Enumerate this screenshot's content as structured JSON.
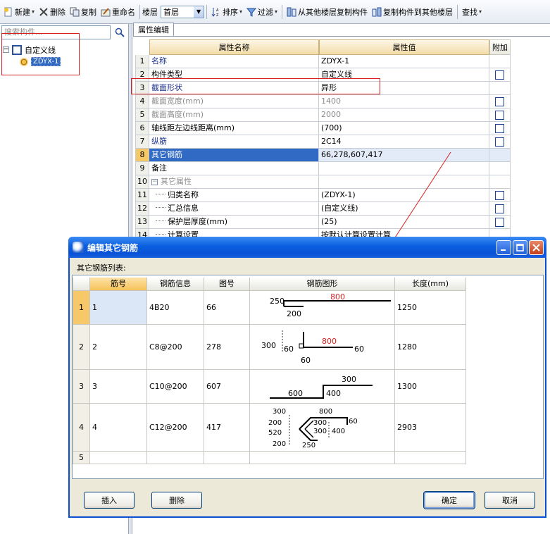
{
  "toolbar": {
    "new_label": "新建",
    "delete_label": "删除",
    "copy_label": "复制",
    "rename_label": "重命名",
    "floor_label": "楼层",
    "floor_value": "首层",
    "sort_label": "排序",
    "filter_label": "过滤",
    "copy_from_label": "从其他楼层复制构件",
    "copy_to_label": "复制构件到其他楼层",
    "find_label": "查找"
  },
  "left_panel": {
    "search_placeholder": "搜索构件...",
    "tree_root_label": "自定义线",
    "tree_child_label": "ZDYX-1"
  },
  "prop_grid": {
    "tab_label": "属性编辑",
    "col_name": "属性名称",
    "col_value": "属性值",
    "col_extra": "附加",
    "rows": [
      {
        "num": "1",
        "name": "名称",
        "value": "ZDYX-1"
      },
      {
        "num": "2",
        "name": "构件类型",
        "value": "自定义线"
      },
      {
        "num": "3",
        "name": "截面形状",
        "value": "异形"
      },
      {
        "num": "4",
        "name": "截面宽度(mm)",
        "value": "1400"
      },
      {
        "num": "5",
        "name": "截面高度(mm)",
        "value": "2000"
      },
      {
        "num": "6",
        "name": "轴线距左边线距离(mm)",
        "value": "(700)"
      },
      {
        "num": "7",
        "name": "纵筋",
        "value": "2C14"
      },
      {
        "num": "8",
        "name": "其它钢筋",
        "value": "66,278,607,417"
      },
      {
        "num": "9",
        "name": "备注",
        "value": ""
      },
      {
        "num": "10",
        "name": "其它属性",
        "value": ""
      },
      {
        "num": "11",
        "name": "归类名称",
        "value": "(ZDYX-1)"
      },
      {
        "num": "12",
        "name": "汇总信息",
        "value": "(自定义线)"
      },
      {
        "num": "13",
        "name": "保护层厚度(mm)",
        "value": "(25)"
      },
      {
        "num": "14",
        "name": "计算设置",
        "value": "按默认计算设置计算"
      }
    ]
  },
  "dialog": {
    "title": "编辑其它钢筋",
    "list_label": "其它钢筋列表:",
    "col_bar": "筋号",
    "col_info": "钢筋信息",
    "col_fig": "图号",
    "col_shape": "钢筋图形",
    "col_len": "长度(mm)",
    "rows": [
      {
        "num": "1",
        "bar": "1",
        "info": "4B20",
        "fig": "66",
        "len": "1250"
      },
      {
        "num": "2",
        "bar": "2",
        "info": "C8@200",
        "fig": "278",
        "len": "1280"
      },
      {
        "num": "3",
        "bar": "3",
        "info": "C10@200",
        "fig": "607",
        "len": "1300"
      },
      {
        "num": "4",
        "bar": "4",
        "info": "C12@200",
        "fig": "417",
        "len": "2903"
      },
      {
        "num": "5",
        "bar": "",
        "info": "",
        "fig": "",
        "len": ""
      }
    ],
    "shape_dims": {
      "r1": {
        "a": "250",
        "b": "800",
        "c": "200"
      },
      "r2": {
        "a": "300",
        "b": "60",
        "c": "800",
        "d": "60",
        "e": "60"
      },
      "r3": {
        "a": "300",
        "b": "600",
        "c": "400"
      },
      "r4": {
        "a": "300",
        "b": "800",
        "c": "200",
        "d": "300",
        "e": "60",
        "f": "520",
        "g": "300",
        "h": "400",
        "i": "200",
        "j": "250"
      }
    },
    "insert_label": "插入",
    "delete_label": "删除",
    "ok_label": "确定",
    "cancel_label": "取消"
  },
  "colors": {
    "accent_red": "#d82020",
    "selection_blue": "#316ac5",
    "title_blue": "#0a5fe0"
  }
}
